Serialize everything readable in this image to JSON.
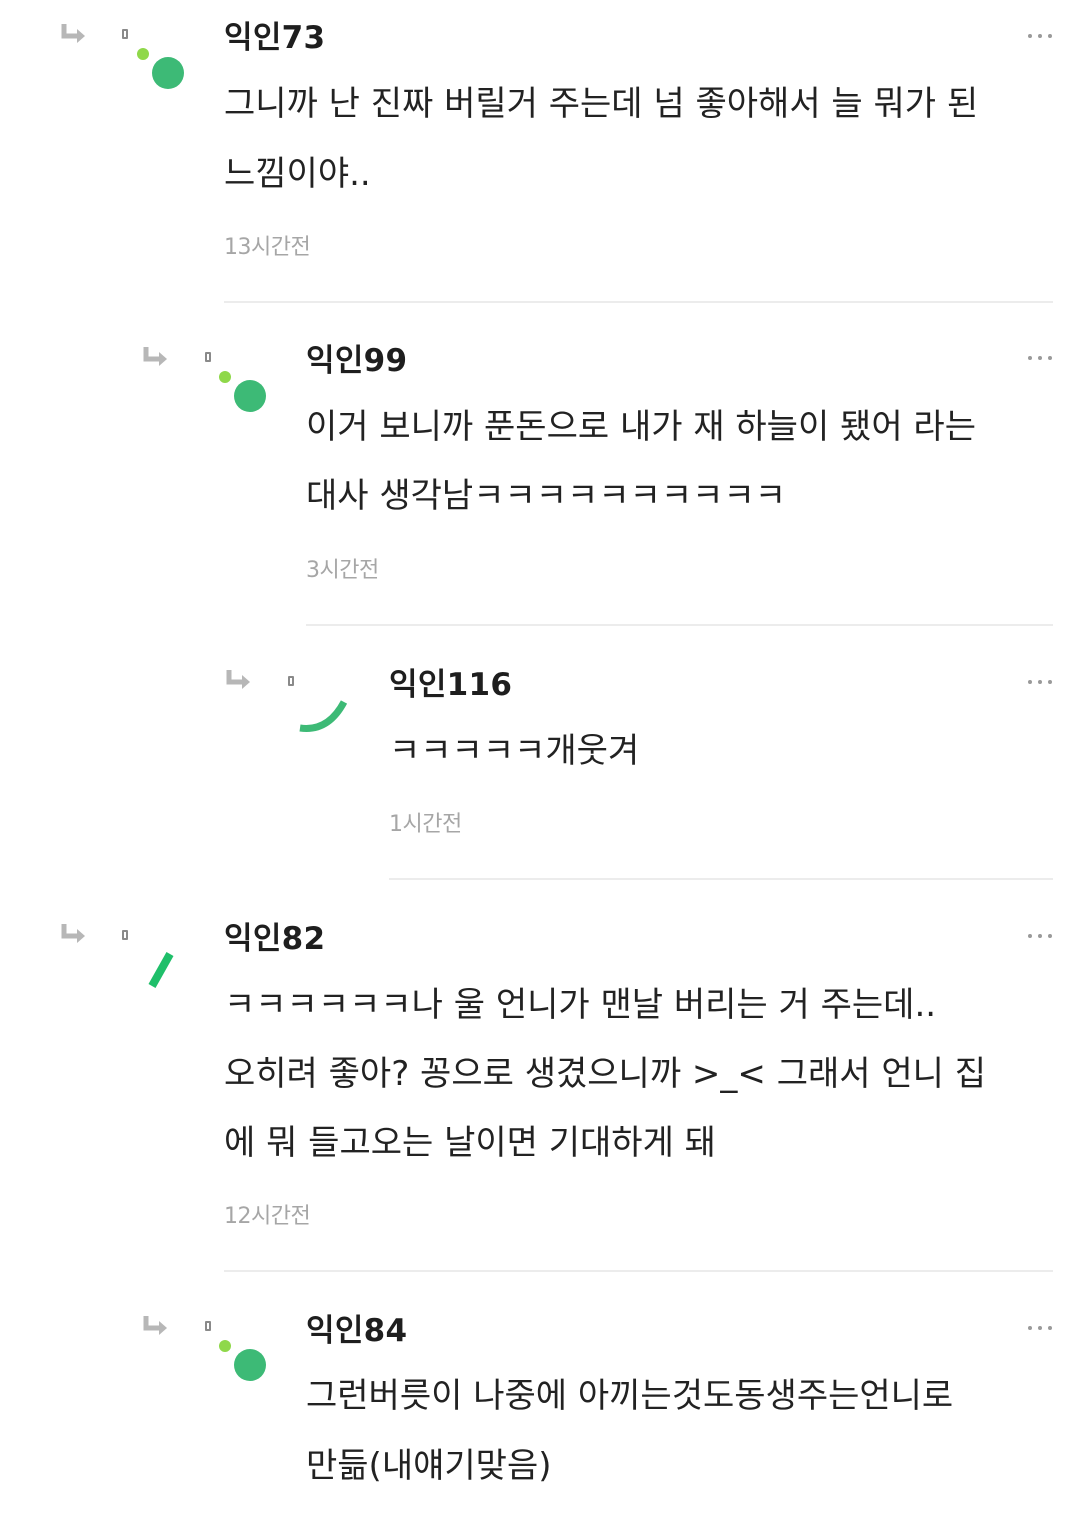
{
  "comments": [
    {
      "username": "익인73",
      "lines": [
        "그니까 난 진짜 버릴거 주는데 넘 좋아해서 늘 뭐가 된",
        "느낌이야.."
      ],
      "time": "13시간전",
      "avatar_icon": "green-dot-avatar-icon"
    },
    {
      "username": "익인99",
      "lines": [
        "이거 보니까 푼돈으로 내가 재 하늘이 됐어 라는",
        "대사 생각남ㅋㅋㅋㅋㅋㅋㅋㅋㅋㅋ"
      ],
      "time": "3시간전",
      "avatar_icon": "green-dot-avatar-icon"
    },
    {
      "username": "익인116",
      "lines": [
        "ㅋㅋㅋㅋㅋ개웃겨"
      ],
      "time": "1시간전",
      "avatar_icon": "green-arc-avatar-icon"
    },
    {
      "username": "익인82",
      "lines": [
        "ㅋㅋㅋㅋㅋㅋ나 울 언니가 맨날 버리는 거 주는데..",
        "오히려 좋아? 꽁으로 생겼으니까 >_< 그래서 언니 집",
        "에 뭐 들고오는 날이면 기대하게 돼"
      ],
      "time": "12시간전",
      "avatar_icon": "green-stroke-avatar-icon"
    },
    {
      "username": "익인84",
      "lines": [
        "그런버릇이 나중에 아끼는것도동생주는언니로",
        "만듦(내얘기맞음)"
      ],
      "avatar_icon": "green-dot-avatar-icon"
    }
  ],
  "colors": {
    "accent_green": "#3dba76",
    "light_green": "#8fd84a",
    "text": "#222222",
    "time": "#a6a6a6",
    "divider": "#ececec",
    "icon_gray": "#9a9a9a"
  }
}
